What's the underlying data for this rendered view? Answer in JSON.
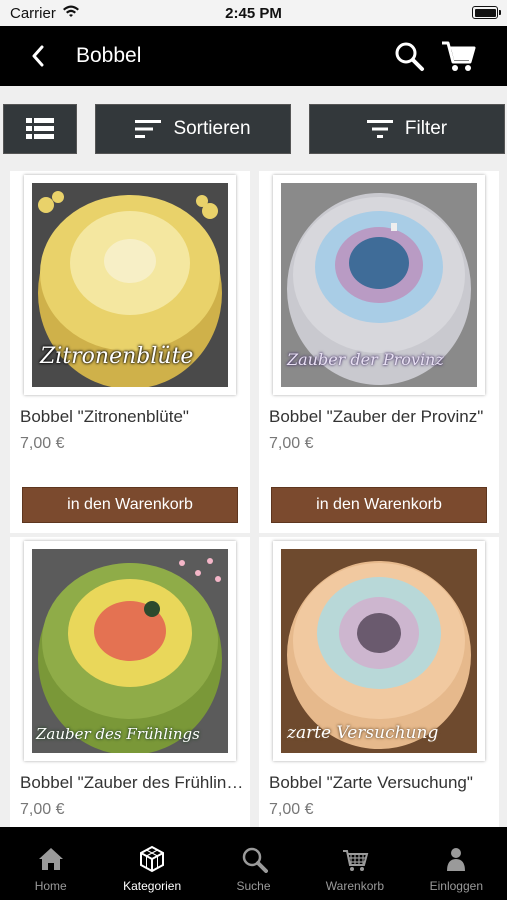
{
  "status_bar": {
    "carrier": "Carrier",
    "time": "2:45 PM"
  },
  "nav": {
    "title": "Bobbel"
  },
  "toolbar": {
    "sort_label": "Sortieren",
    "filter_label": "Filter"
  },
  "products": [
    {
      "name": "Bobbel \"Zitronenblüte\"",
      "price": "7,00 €",
      "button": "in den Warenkorb",
      "image_caption": "Zitronenblüte",
      "colors": [
        "#f4e7a0",
        "#e9d26a",
        "#cfb14a"
      ]
    },
    {
      "name": "Bobbel \"Zauber der Provinz\"",
      "price": "7,00 €",
      "button": "in den Warenkorb",
      "image_caption": "Zauber der Provinz",
      "colors": [
        "#d7d7dc",
        "#a9cde6",
        "#3f6c98"
      ]
    },
    {
      "name": "Bobbel \"Zauber des Frühlings\"",
      "price": "7,00 €",
      "image_caption": "Zauber des Frühlings",
      "colors": [
        "#8fac48",
        "#e9d75a",
        "#e47252"
      ]
    },
    {
      "name": "Bobbel \"Zarte Versuchung\"",
      "price": "7,00 €",
      "image_caption": "zarte Versuchung",
      "colors": [
        "#f1c9a0",
        "#b8d8d8",
        "#6a5a6e"
      ]
    }
  ],
  "tabbar": {
    "home": "Home",
    "categories": "Kategorien",
    "search": "Suche",
    "cart": "Warenkorb",
    "login": "Einloggen"
  },
  "icons": [
    "wifi-icon",
    "battery-icon",
    "back-chevron-icon",
    "search-icon",
    "cart-icon",
    "list-view-icon",
    "sort-icon",
    "filter-icon",
    "home-icon",
    "cube-icon",
    "magnifier-icon",
    "basket-icon",
    "person-icon"
  ],
  "colors": {
    "accent_button": "#7b4a2e",
    "nav_background": "#000000",
    "toolbar_button": "#33383b"
  }
}
